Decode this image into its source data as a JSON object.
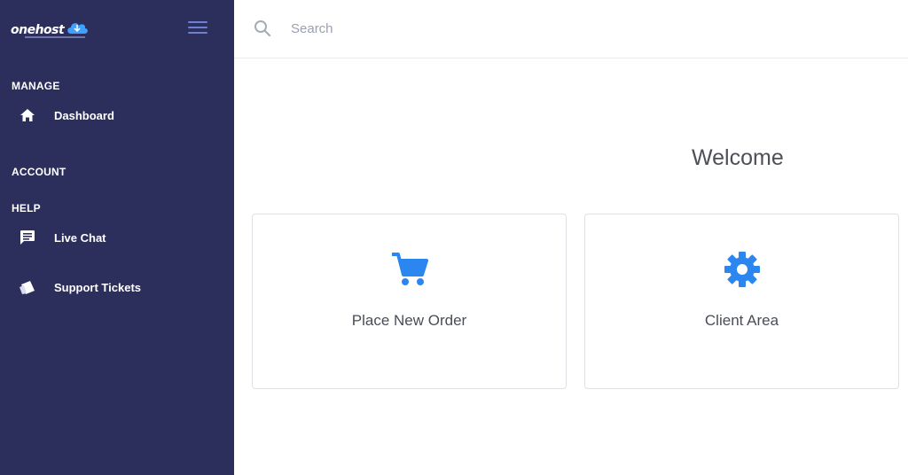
{
  "brand": {
    "name": "onehost",
    "icon": "cloud-logo-icon"
  },
  "sidebar": {
    "toggle_icon": "hamburger-menu-icon",
    "sections": {
      "manage": "MANAGE",
      "account": "ACCOUNT",
      "help": "HELP"
    },
    "items": [
      {
        "label": "Dashboard",
        "icon": "home-icon"
      },
      {
        "label": "Live Chat",
        "icon": "chat-icon"
      },
      {
        "label": "Support Tickets",
        "icon": "ticket-icon"
      }
    ]
  },
  "search": {
    "placeholder": "Search",
    "value": "",
    "icon": "search-icon"
  },
  "main": {
    "welcome": "Welcome",
    "cards": [
      {
        "label": "Place New Order",
        "icon": "cart-icon"
      },
      {
        "label": "Client Area",
        "icon": "gear-icon"
      }
    ]
  },
  "colors": {
    "sidebar_bg": "#2c2f5c",
    "accent_blue": "#2b86f0",
    "toggle": "#6f7fd1",
    "text_dark": "#4a4d57"
  }
}
